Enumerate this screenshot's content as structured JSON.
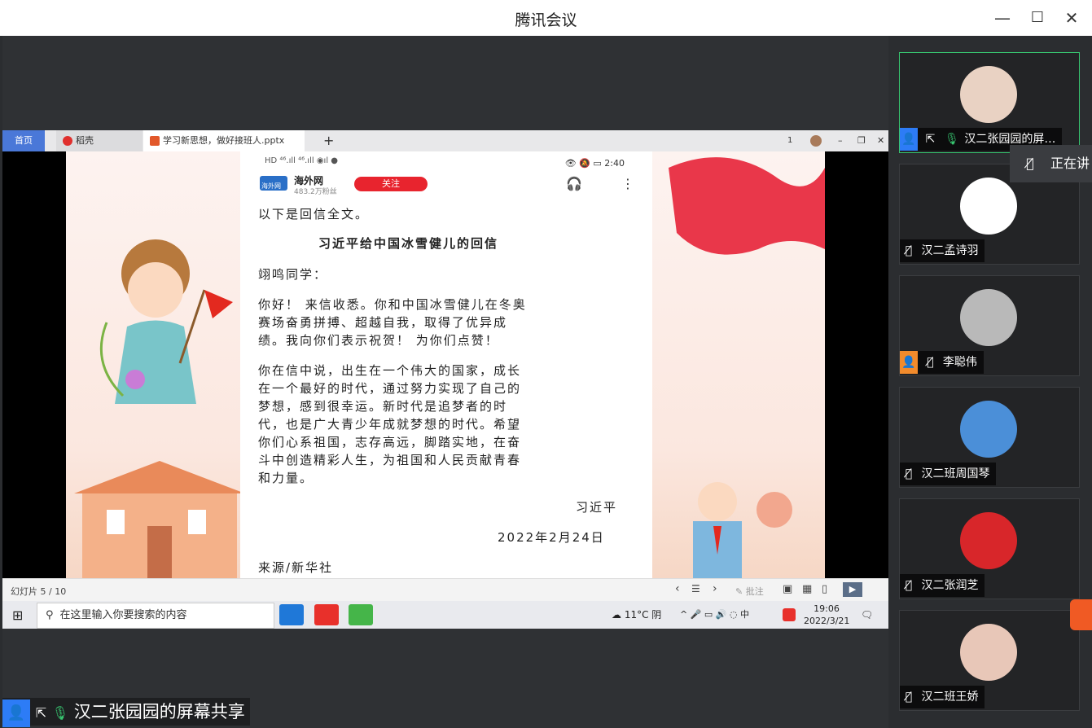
{
  "window": {
    "title": "腾讯会议",
    "minimize": "—",
    "maximize": "☐",
    "close": "✕"
  },
  "wps": {
    "tabs": [
      "首页",
      "稻壳",
      "学习新思想，做好接班人.pptx"
    ],
    "add_tab": "+",
    "page_badge": "1",
    "controls": [
      "–",
      "❐",
      "✕"
    ]
  },
  "phone": {
    "status_left": "HD ⁴⁶.ıll ⁴⁶.ıll ◉ıl ●",
    "status_right": "👁 🔕 ▭ 2:40",
    "account": "海外网",
    "fans": "483.2万粉丝",
    "follow": "关注",
    "logo_text": "海外网"
  },
  "letter": {
    "intro": "以下是回信全文。",
    "title": "习近平给中国冰雪健儿的回信",
    "salutation": "翊鸣同学：",
    "p1": [
      "你好！ 来信收悉。你和中国冰雪健儿在冬奥",
      "赛场奋勇拼搏、超越自我，取得了优异成",
      "绩。我向你们表示祝贺！ 为你们点赞！"
    ],
    "p2": [
      "你在信中说，出生在一个伟大的国家，成长",
      "在一个最好的时代，通过努力实现了自己的",
      "梦想，感到很幸运。新时代是追梦者的时",
      "代，也是广大青少年成就梦想的时代。希望",
      "你们心系祖国，志存高远，脚踏实地，在奋",
      "斗中创造精彩人生，为祖国和人民贡献青春",
      "和力量。"
    ],
    "signature": "习近平",
    "date": "2022年2月24日",
    "source": "来源/新华社"
  },
  "ppt_status": {
    "slide": "幻灯片 5 / 10",
    "comment": "批注"
  },
  "taskbar": {
    "search_placeholder": "在这里输入你要搜索的内容",
    "weather": "11°C  阴",
    "time": "19:06",
    "date": "2022/3/21",
    "ime": "中"
  },
  "participants": [
    {
      "name": "汉二张园园的屏…",
      "muted": false,
      "active": true
    },
    {
      "name": "汉二孟诗羽",
      "muted": true,
      "active": false
    },
    {
      "name": "李聪伟",
      "muted": true,
      "active": false
    },
    {
      "name": "汉二班周国琴",
      "muted": true,
      "active": false
    },
    {
      "name": "汉二张润芝",
      "muted": true,
      "active": false
    },
    {
      "name": "汉二班王娇",
      "muted": true,
      "active": false
    }
  ],
  "toast": "正在讲",
  "share_label": "汉二张园园的屏幕共享",
  "colors": {
    "active_border": "#37c46f",
    "accent_blue": "#2d7cf6",
    "follow_red": "#e8242e"
  }
}
